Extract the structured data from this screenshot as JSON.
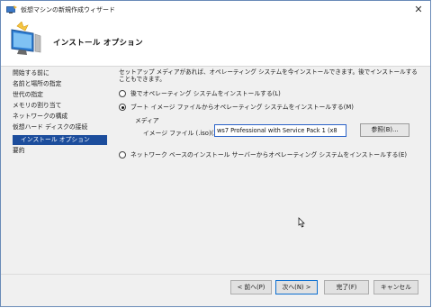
{
  "window": {
    "title": "仮想マシンの新規作成ウィザード",
    "close_glyph": "✕"
  },
  "header": {
    "title": "インストール オプション"
  },
  "sidebar": {
    "items": [
      {
        "label": "開始する前に"
      },
      {
        "label": "名前と場所の指定"
      },
      {
        "label": "世代の指定"
      },
      {
        "label": "メモリの割り当て"
      },
      {
        "label": "ネットワークの構成"
      },
      {
        "label": "仮想ハード ディスクの接続"
      },
      {
        "label": "インストール オプション",
        "current": true
      },
      {
        "label": "要約"
      }
    ]
  },
  "main": {
    "description": "セットアップ メディアがあれば、オペレーティング システムを今インストールできます。後でインストールすることもできます。",
    "options": [
      {
        "label": "後でオペレーティング システムをインストールする(L)",
        "checked": false
      },
      {
        "label": "ブート イメージ ファイルからオペレーティング システムをインストールする(M)",
        "checked": true
      },
      {
        "label": "ネットワーク ベースのインストール サーバーからオペレーティング システムをインストールする(E)",
        "checked": false
      }
    ],
    "media": {
      "group_label": "メディア",
      "iso_label": "イメージ ファイル (.iso)(X):",
      "iso_value": "ws7 Professional with Service Pack 1 (x8",
      "browse_label": "参照(B)..."
    }
  },
  "footer": {
    "back_label": "< 前へ(P)",
    "next_label": "次へ(N) >",
    "finish_label": "完了(F)",
    "cancel_label": "キャンセル"
  },
  "icons": {
    "app": "hyperv-wizard-icon",
    "header": "monitor-install-icon",
    "cursor": "mouse-pointer-icon"
  },
  "colors": {
    "selection": "#1c4d9c",
    "default_button_border": "#0c6ed0",
    "input_focus_border": "#2a62c8"
  }
}
